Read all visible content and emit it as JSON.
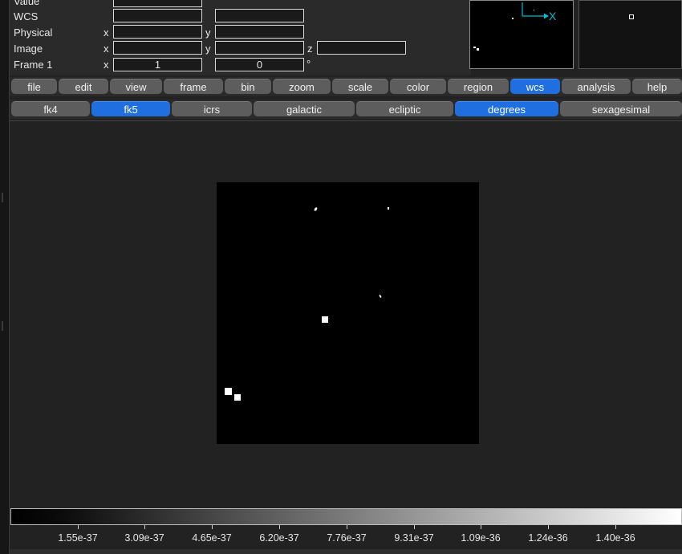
{
  "info": {
    "value_label": "Value",
    "wcs_label": "WCS",
    "physical_label": "Physical",
    "image_label": "Image",
    "frame_label": "Frame 1",
    "x_axis": "x",
    "y_axis": "y",
    "z_axis": "z",
    "frame_x_value": "1",
    "frame_y_value": "0",
    "degree_symbol": "°"
  },
  "panner": {
    "x_axis_label": "X"
  },
  "menu": {
    "items": [
      "file",
      "edit",
      "view",
      "frame",
      "bin",
      "zoom",
      "scale",
      "color",
      "region",
      "wcs",
      "analysis",
      "help"
    ],
    "active": "wcs"
  },
  "wcs_bar": {
    "items": [
      "fk4",
      "fk5",
      "icrs",
      "galactic",
      "ecliptic",
      "degrees",
      "sexagesimal"
    ],
    "active": [
      "fk5",
      "degrees"
    ]
  },
  "colorbar": {
    "ticks": [
      "1.55e-37",
      "3.09e-37",
      "4.65e-37",
      "6.20e-37",
      "7.76e-37",
      "9.31e-37",
      "1.09e-36",
      "1.24e-36",
      "1.40e-36"
    ]
  },
  "colors": {
    "accent": "#1f6fe0",
    "button": "#5d5d5d",
    "panner_axis": "#00bcd4"
  }
}
